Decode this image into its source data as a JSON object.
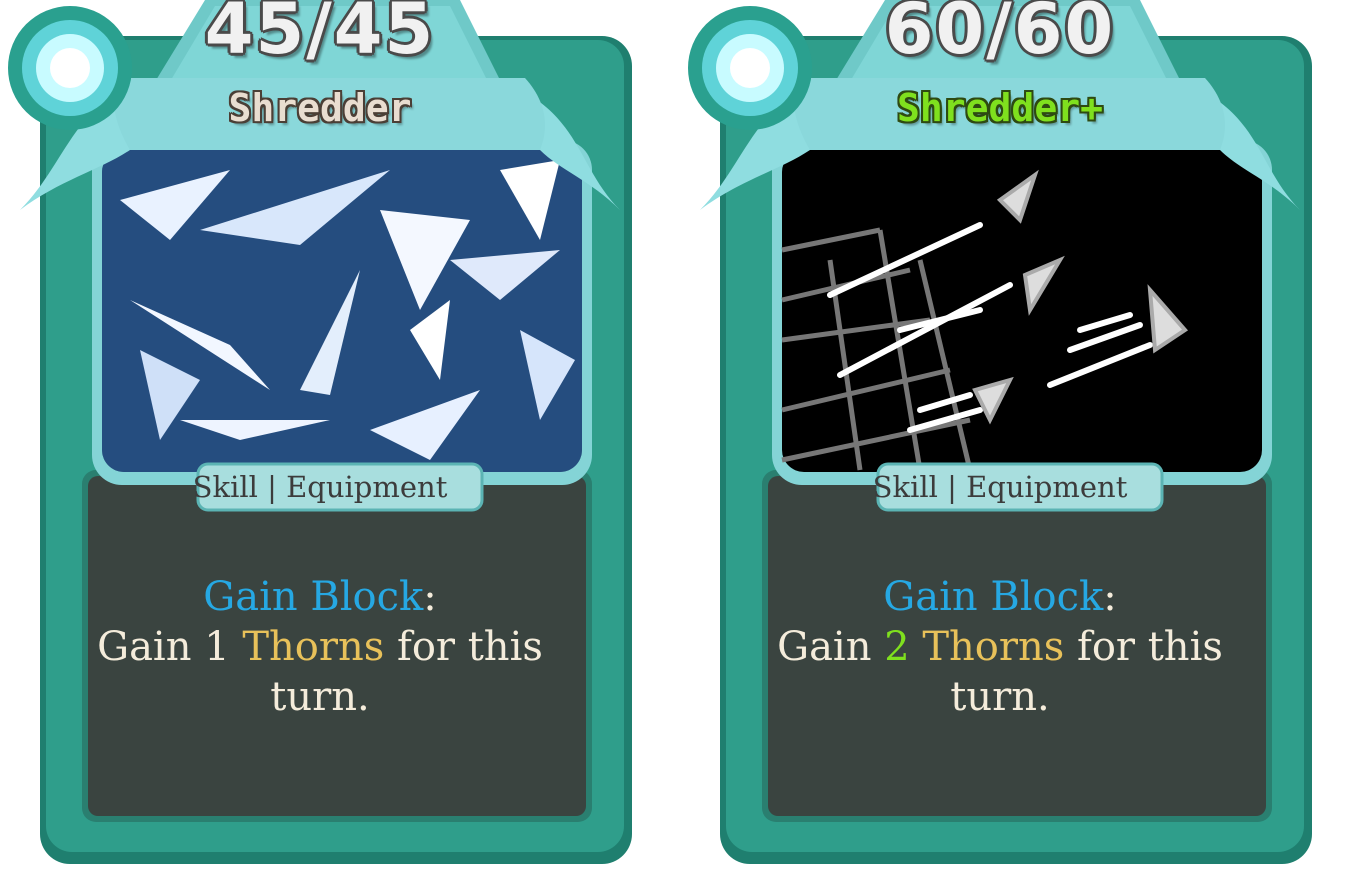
{
  "cards": [
    {
      "cost": "45/45",
      "title": "Shredder",
      "upgraded": false,
      "type_label": "Skill | Equipment",
      "description": {
        "keyword1": "Gain Block",
        "colon": ":",
        "line2_prefix": "Gain ",
        "amount": "1",
        "keyword2": "Thorns",
        "line2_suffix": " for this",
        "line3": "turn."
      },
      "art": "shards-art"
    },
    {
      "cost": "60/60",
      "title": "Shredder+",
      "upgraded": true,
      "type_label": "Skill | Equipment",
      "description": {
        "keyword1": "Gain Block",
        "colon": ":",
        "line2_prefix": "Gain ",
        "amount": "2",
        "keyword2": "Thorns",
        "line2_suffix": " for this",
        "line3": "turn."
      },
      "art": "sketch-art"
    }
  ],
  "colors": {
    "card_frame": "#2f9e8b",
    "banner": "#8fdde0",
    "text_panel": "#3a4440",
    "keyword_blue": "#26a8e3",
    "keyword_gold": "#e8c15a",
    "upgrade_green": "#7fe01e"
  }
}
